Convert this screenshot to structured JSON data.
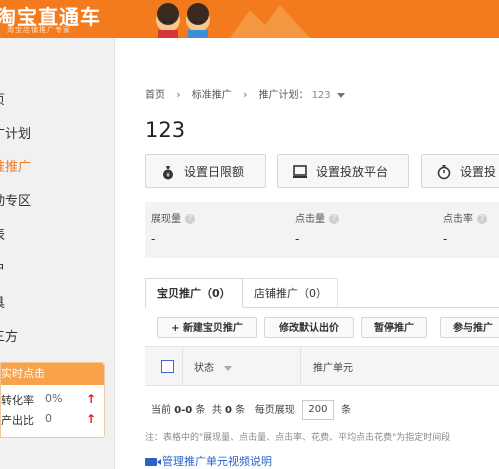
{
  "header": {
    "logo_title": "淘宝直通车",
    "logo_subtitle": "淘宝店铺推广专家"
  },
  "sidebar": {
    "items": [
      {
        "label": "页",
        "active": false
      },
      {
        "label": "广计划",
        "active": false
      },
      {
        "label": "准推广",
        "active": true
      },
      {
        "label": "动专区",
        "active": false
      },
      {
        "label": "表",
        "active": false
      },
      {
        "label": "户",
        "active": false
      },
      {
        "label": "具",
        "active": false
      },
      {
        "label": "三方",
        "active": false
      }
    ],
    "realtime": {
      "title": "实时点击",
      "rows": [
        {
          "label": "转化率",
          "value": "0%"
        },
        {
          "label": "产出比",
          "value": "0"
        }
      ]
    }
  },
  "breadcrumb": {
    "home": "首页",
    "section": "标准推广",
    "plan_label": "推广计划：",
    "plan_value": "123"
  },
  "plan_title": "123",
  "actions": {
    "daily_limit": "设置日限额",
    "platform": "设置投放平台",
    "schedule": "设置投"
  },
  "stats": [
    {
      "label": "展现量",
      "value": "-"
    },
    {
      "label": "点击量",
      "value": "-"
    },
    {
      "label": "点击率",
      "value": "-"
    }
  ],
  "tabs": [
    {
      "label": "宝贝推广（0）",
      "active": true
    },
    {
      "label": "店铺推广（0）",
      "active": false
    }
  ],
  "toolbar": {
    "new": "新建宝贝推广",
    "edit_default_bid": "修改默认出价",
    "pause": "暂停推广",
    "join": "参与推广"
  },
  "table": {
    "columns": [
      "状态",
      "推广单元"
    ]
  },
  "pager": {
    "current_prefix": "当前",
    "current_range": "0-0",
    "unit": "条",
    "total_prefix": "共",
    "total": "0",
    "per_page_label": "每页展现",
    "per_page": "200"
  },
  "note": "注：表格中的\"展现量、点击量、点击率、花费、平均点击花费\"为指定时间段",
  "video_link": "管理推广单元视频说明",
  "colors": {
    "brand_orange": "#f37b1d",
    "link_blue": "#2a62c9"
  }
}
